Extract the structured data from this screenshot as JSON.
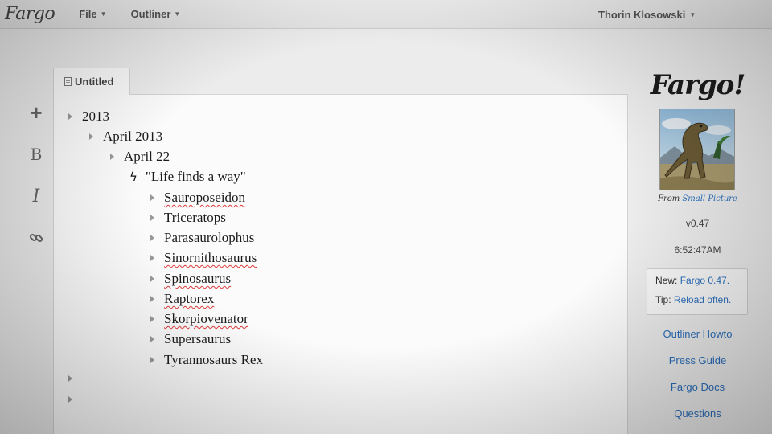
{
  "navbar": {
    "brand": "Fargo",
    "menus": [
      "File",
      "Outliner"
    ],
    "user": "Thorin Klosowski"
  },
  "toolbar": {
    "icons": [
      "plus-icon",
      "bold-icon",
      "italic-icon",
      "link-icon"
    ],
    "plus": "+",
    "bold": "B",
    "italic": "I"
  },
  "tab": {
    "label": "Untitled"
  },
  "outline": {
    "year": "2013",
    "month": "April 2013",
    "day": "April 22",
    "quote": "\"Life finds a way\"",
    "dinosaurs": [
      "Sauroposeidon",
      "Triceratops",
      "Parasaurolophus",
      "Sinornithosaurus",
      "Spinosaurus",
      "Raptorex",
      "Skorpiovenator",
      "Supersaurus",
      "Tyrannosaurs Rex"
    ]
  },
  "sidebar": {
    "title": "Fargo!",
    "credit_prefix": "From",
    "credit_link": "Small Picture",
    "version": "v0.47",
    "time": "6:52:47AM",
    "news_label": "New:",
    "news_link": "Fargo 0.47.",
    "tip_label": "Tip:",
    "tip_link": "Reload often.",
    "links": [
      "Outliner Howto",
      "Press Guide",
      "Fargo Docs",
      "Questions"
    ]
  }
}
